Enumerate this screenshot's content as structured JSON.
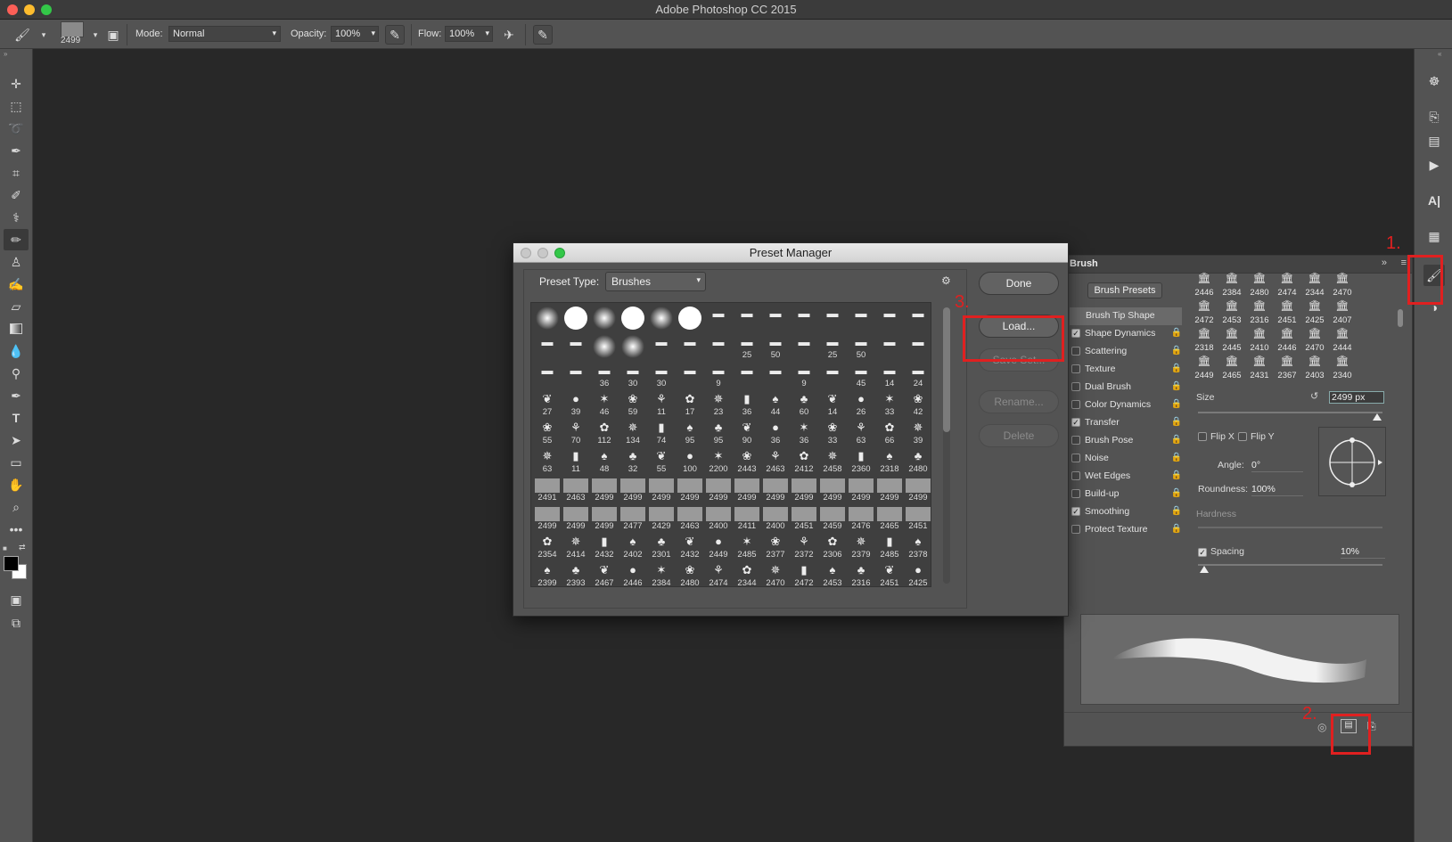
{
  "app": {
    "title": "Adobe Photoshop CC 2015",
    "traffic_colors": [
      "#fc5f57",
      "#fdbc2e",
      "#33c748"
    ]
  },
  "options_bar": {
    "brush_size": "2499",
    "mode_label": "Mode:",
    "mode_value": "Normal",
    "opacity_label": "Opacity:",
    "opacity_value": "100%",
    "flow_label": "Flow:",
    "flow_value": "100%"
  },
  "tools": [
    "move-tool",
    "marquee-tool",
    "lasso-tool",
    "quick-selection-tool",
    "crop-tool",
    "eyedropper-tool",
    "healing-tool",
    "brush-tool",
    "stamp-tool",
    "history-brush-tool",
    "eraser-tool",
    "gradient-tool",
    "blur-tool",
    "dodge-tool",
    "pen-tool",
    "type-tool",
    "path-selection-tool",
    "rectangle-tool",
    "hand-tool",
    "zoom-tool",
    "more-tools"
  ],
  "preset_manager": {
    "title": "Preset Manager",
    "preset_type_label": "Preset Type:",
    "preset_type_value": "Brushes",
    "buttons": {
      "done": "Done",
      "load": "Load...",
      "save_set": "Save Set...",
      "rename": "Rename...",
      "delete": "Delete"
    },
    "rows": [
      [
        "",
        "",
        "",
        "",
        "",
        "",
        "",
        "",
        "",
        "",
        "",
        "",
        "",
        ""
      ],
      [
        "",
        "",
        "",
        "",
        "",
        "",
        "",
        "25",
        "50",
        "",
        "25",
        "50",
        "",
        ""
      ],
      [
        "",
        "",
        "36",
        "30",
        "30",
        "",
        "9",
        "",
        "",
        "9",
        "",
        "45",
        "14",
        "24"
      ],
      [
        "27",
        "39",
        "46",
        "59",
        "11",
        "17",
        "23",
        "36",
        "44",
        "60",
        "14",
        "26",
        "33",
        "42"
      ],
      [
        "55",
        "70",
        "112",
        "134",
        "74",
        "95",
        "95",
        "90",
        "36",
        "36",
        "33",
        "63",
        "66",
        "39"
      ],
      [
        "63",
        "11",
        "48",
        "32",
        "55",
        "100",
        "2200",
        "2443",
        "2463",
        "2412",
        "2458",
        "2360",
        "2318",
        "2480"
      ],
      [
        "2491",
        "2463",
        "2499",
        "2499",
        "2499",
        "2499",
        "2499",
        "2499",
        "2499",
        "2499",
        "2499",
        "2499",
        "2499",
        "2499"
      ],
      [
        "2499",
        "2499",
        "2499",
        "2477",
        "2429",
        "2463",
        "2400",
        "2411",
        "2400",
        "2451",
        "2459",
        "2476",
        "2465",
        "2451"
      ],
      [
        "2354",
        "2414",
        "2432",
        "2402",
        "2301",
        "2432",
        "2449",
        "2485",
        "2377",
        "2372",
        "2306",
        "2379",
        "2485",
        "2378"
      ],
      [
        "2399",
        "2393",
        "2467",
        "2446",
        "2384",
        "2480",
        "2474",
        "2344",
        "2470",
        "2472",
        "2453",
        "2316",
        "2451",
        "2425"
      ]
    ]
  },
  "brush_panel": {
    "tab": "Brush",
    "presets_button": "Brush Presets",
    "options": [
      {
        "label": "Brush Tip Shape",
        "checked": null
      },
      {
        "label": "Shape Dynamics",
        "checked": true
      },
      {
        "label": "Scattering",
        "checked": false
      },
      {
        "label": "Texture",
        "checked": false
      },
      {
        "label": "Dual Brush",
        "checked": false
      },
      {
        "label": "Color Dynamics",
        "checked": false
      },
      {
        "label": "Transfer",
        "checked": true
      },
      {
        "label": "Brush Pose",
        "checked": false
      },
      {
        "label": "Noise",
        "checked": false
      },
      {
        "label": "Wet Edges",
        "checked": false
      },
      {
        "label": "Build-up",
        "checked": false
      },
      {
        "label": "Smoothing",
        "checked": true
      },
      {
        "label": "Protect Texture",
        "checked": false
      }
    ],
    "tips": [
      [
        "2446",
        "2384",
        "2480",
        "2474",
        "2344",
        "2470"
      ],
      [
        "2472",
        "2453",
        "2316",
        "2451",
        "2425",
        "2407"
      ],
      [
        "2318",
        "2445",
        "2410",
        "2446",
        "2470",
        "2444"
      ],
      [
        "2449",
        "2465",
        "2431",
        "2367",
        "2403",
        "2340"
      ]
    ],
    "size_label": "Size",
    "size_value": "2499 px",
    "flip_x": "Flip X",
    "flip_y": "Flip Y",
    "angle_label": "Angle:",
    "angle_value": "0°",
    "roundness_label": "Roundness:",
    "roundness_value": "100%",
    "hardness_label": "Hardness",
    "spacing_label": "Spacing",
    "spacing_value": "10%"
  },
  "annotations": {
    "one": "1.",
    "two": "2.",
    "three": "3.",
    "color": "#e02020"
  }
}
